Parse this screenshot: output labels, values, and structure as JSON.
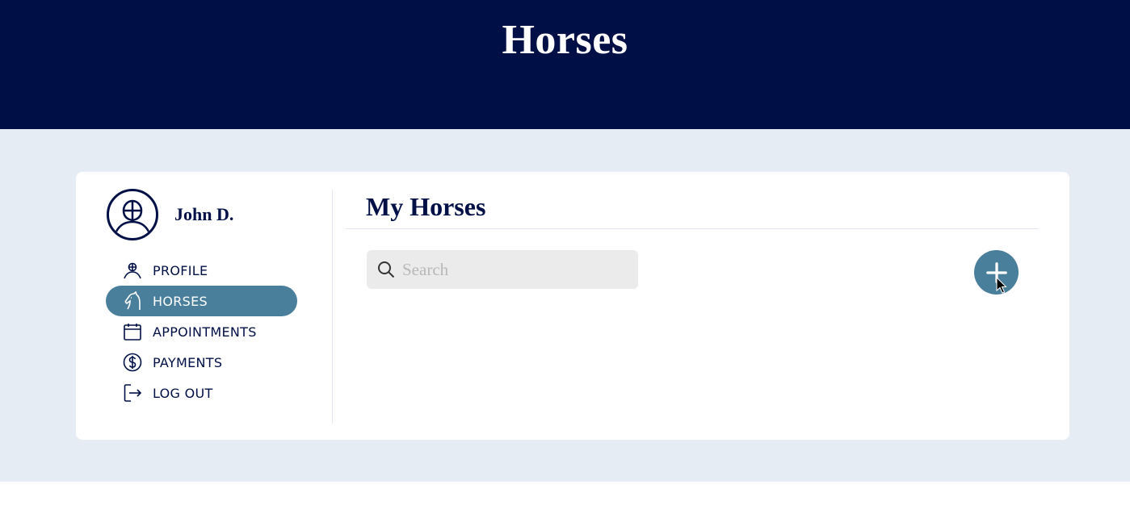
{
  "header": {
    "title": "Horses"
  },
  "user": {
    "name": "John D.",
    "avatar_icon": "user-avatar-icon"
  },
  "nav": {
    "items": [
      {
        "label": "PROFILE",
        "icon": "profile-icon",
        "active": false
      },
      {
        "label": "HORSES",
        "icon": "horse-icon",
        "active": true
      },
      {
        "label": "APPOINTMENTS",
        "icon": "calendar-icon",
        "active": false
      },
      {
        "label": "PAYMENTS",
        "icon": "dollar-icon",
        "active": false
      },
      {
        "label": "LOG OUT",
        "icon": "logout-icon",
        "active": false
      }
    ]
  },
  "main": {
    "title": "My Horses",
    "search": {
      "placeholder": "Search",
      "value": ""
    },
    "add_button_icon": "plus-icon"
  },
  "colors": {
    "header_bg": "#000f45",
    "band_bg": "#e6ecf4",
    "accent": "#4a7f9c",
    "text_primary": "#000f45"
  }
}
